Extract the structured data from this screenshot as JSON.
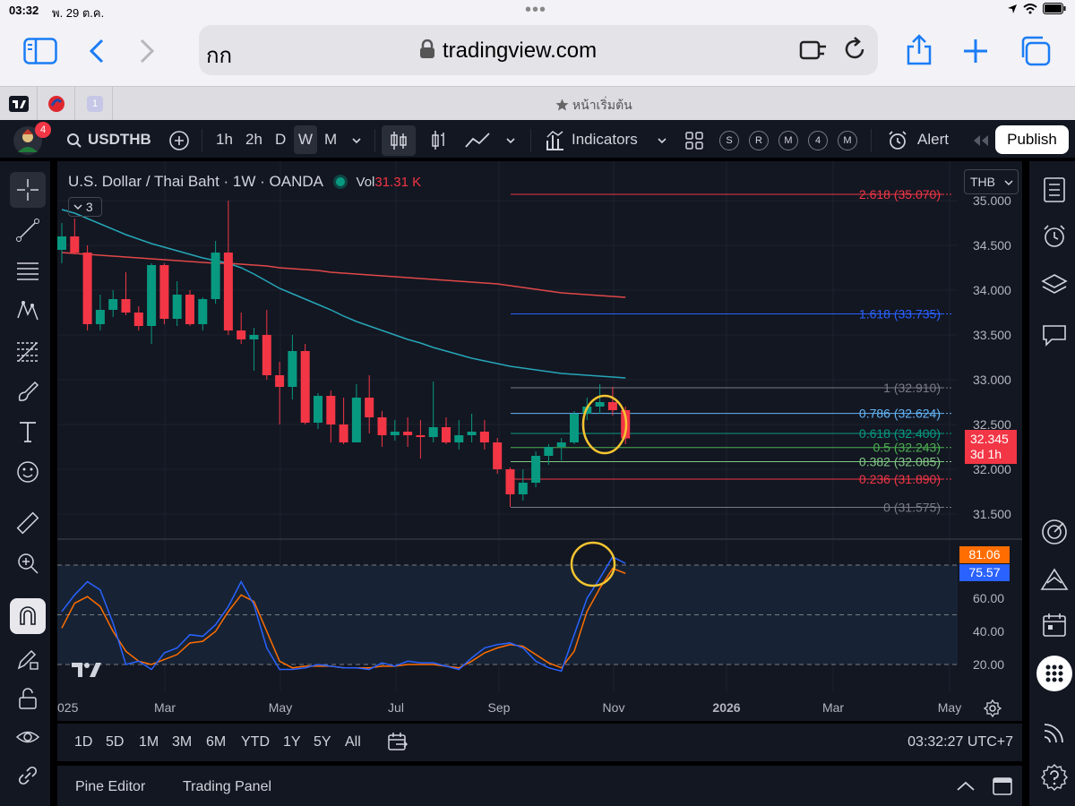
{
  "status": {
    "time": "03:32",
    "date": "พ. 29 ต.ค."
  },
  "safari": {
    "reader_label": "กก",
    "url": "tradingview.com",
    "tab_number": "1",
    "home_tab": "หน้าเริ่มต้น"
  },
  "toolbar": {
    "notification_count": "4",
    "symbol": "USDTHB",
    "intervals": [
      "1h",
      "2h",
      "D",
      "W",
      "M"
    ],
    "active_interval": "W",
    "indicators_label": "Indicators",
    "chips": [
      "S",
      "R",
      "M",
      "4",
      "M"
    ],
    "alert_label": "Alert",
    "publish_label": "Publish"
  },
  "chart": {
    "title": "U.S. Dollar / Thai Baht · 1W · OANDA",
    "vol_label": "Vol",
    "vol_value": "31.31 K",
    "collapse_count": "3",
    "currency": "THB",
    "current_price": "32.345",
    "countdown": "3d 1h",
    "price_axis": [
      "35.000",
      "34.500",
      "34.000",
      "33.500",
      "33.000",
      "32.500",
      "32.000",
      "31.500"
    ],
    "fib_levels": [
      {
        "label": "2.618 (35.070)",
        "value": 35.07,
        "color": "#f23645"
      },
      {
        "label": "1.618 (33.735)",
        "value": 33.735,
        "color": "#2962ff"
      },
      {
        "label": "1 (32.910)",
        "value": 32.91,
        "color": "#787b86"
      },
      {
        "label": "0.786 (32.624)",
        "value": 32.624,
        "color": "#64b5f6"
      },
      {
        "label": "0.618 (32.400)",
        "value": 32.4,
        "color": "#089981"
      },
      {
        "label": "0.5 (32.243)",
        "value": 32.243,
        "color": "#4caf50"
      },
      {
        "label": "0.382 (32.085)",
        "value": 32.085,
        "color": "#81c784"
      },
      {
        "label": "0.236 (31.890)",
        "value": 31.89,
        "color": "#f23645"
      },
      {
        "label": "0 (31.575)",
        "value": 31.575,
        "color": "#787b86"
      }
    ],
    "osc_axis": [
      "60.00",
      "40.00",
      "20.00"
    ],
    "osc_k": "81.06",
    "osc_d": "75.57",
    "time_axis": [
      "025",
      "Mar",
      "May",
      "Jul",
      "Sep",
      "Nov",
      "2026",
      "Mar",
      "May"
    ],
    "colors": {
      "up": "#089981",
      "down": "#f23645",
      "ma_fast": "#26a6b8",
      "ma_slow": "#e04848",
      "k": "#2962ff",
      "d": "#ff6d00",
      "highlight": "#f5c531"
    }
  },
  "chart_data": {
    "type": "candlestick",
    "title": "U.S. Dollar / Thai Baht · 1W · OANDA",
    "x_ticks": [
      "025",
      "Mar",
      "May",
      "Jul",
      "Sep",
      "Nov",
      "2026",
      "Mar",
      "May"
    ],
    "ylim": [
      31.3,
      35.3
    ],
    "candles": [
      [
        34.45,
        34.75,
        34.3,
        34.6
      ],
      [
        34.6,
        34.8,
        34.4,
        34.42
      ],
      [
        34.42,
        34.5,
        33.55,
        33.62
      ],
      [
        33.62,
        33.95,
        33.55,
        33.78
      ],
      [
        33.78,
        34.0,
        33.7,
        33.9
      ],
      [
        33.9,
        34.2,
        33.72,
        33.75
      ],
      [
        33.75,
        33.82,
        33.55,
        33.6
      ],
      [
        33.6,
        34.3,
        33.4,
        34.28
      ],
      [
        34.28,
        34.3,
        33.62,
        33.68
      ],
      [
        33.68,
        34.1,
        33.6,
        33.95
      ],
      [
        33.95,
        34.0,
        33.6,
        33.62
      ],
      [
        33.62,
        33.92,
        33.55,
        33.9
      ],
      [
        33.9,
        34.55,
        33.85,
        34.42
      ],
      [
        34.42,
        35.0,
        33.5,
        33.55
      ],
      [
        33.55,
        33.75,
        33.4,
        33.45
      ],
      [
        33.45,
        33.58,
        33.1,
        33.5
      ],
      [
        33.5,
        33.78,
        33.0,
        33.05
      ],
      [
        33.05,
        33.2,
        32.5,
        32.92
      ],
      [
        32.92,
        33.5,
        32.78,
        33.32
      ],
      [
        33.32,
        33.4,
        32.5,
        32.52
      ],
      [
        32.52,
        32.85,
        32.45,
        32.82
      ],
      [
        32.82,
        32.88,
        32.3,
        32.5
      ],
      [
        32.5,
        32.8,
        32.28,
        32.3
      ],
      [
        32.3,
        32.95,
        32.3,
        32.8
      ],
      [
        32.8,
        33.05,
        32.4,
        32.58
      ],
      [
        32.58,
        32.65,
        32.25,
        32.38
      ],
      [
        32.38,
        32.55,
        32.32,
        32.42
      ],
      [
        32.42,
        32.58,
        32.25,
        32.38
      ],
      [
        32.38,
        32.55,
        32.12,
        32.36
      ],
      [
        32.36,
        32.98,
        32.3,
        32.47
      ],
      [
        32.47,
        32.58,
        32.28,
        32.3
      ],
      [
        32.3,
        32.55,
        32.22,
        32.38
      ],
      [
        32.38,
        32.62,
        32.3,
        32.42
      ],
      [
        32.42,
        32.55,
        32.22,
        32.3
      ],
      [
        32.3,
        32.35,
        31.95,
        32.0
      ],
      [
        32.0,
        32.02,
        31.58,
        31.72
      ],
      [
        31.72,
        32.0,
        31.65,
        31.85
      ],
      [
        31.85,
        32.2,
        31.8,
        32.15
      ],
      [
        32.15,
        32.28,
        32.05,
        32.25
      ],
      [
        32.25,
        32.35,
        32.1,
        32.3
      ],
      [
        32.3,
        32.65,
        32.28,
        32.62
      ],
      [
        32.62,
        32.8,
        32.55,
        32.7
      ],
      [
        32.7,
        32.95,
        32.62,
        32.75
      ],
      [
        32.75,
        32.92,
        32.6,
        32.66
      ],
      [
        32.66,
        32.7,
        32.28,
        32.345
      ]
    ],
    "ma_fast": [
      34.9,
      34.86,
      34.8,
      34.74,
      34.68,
      34.62,
      34.57,
      34.52,
      34.48,
      34.44,
      34.4,
      34.36,
      34.33,
      34.3,
      34.25,
      34.18,
      34.1,
      34.02,
      33.96,
      33.9,
      33.84,
      33.78,
      33.71,
      33.65,
      33.6,
      33.55,
      33.5,
      33.45,
      33.41,
      33.36,
      33.32,
      33.28,
      33.24,
      33.21,
      33.18,
      33.15,
      33.13,
      33.11,
      33.09,
      33.07,
      33.06,
      33.05,
      33.04,
      33.03,
      33.02
    ],
    "ma_slow": [
      34.42,
      34.41,
      34.4,
      34.39,
      34.38,
      34.37,
      34.36,
      34.35,
      34.34,
      34.33,
      34.32,
      34.31,
      34.3,
      34.3,
      34.29,
      34.28,
      34.27,
      34.25,
      34.24,
      34.23,
      34.22,
      34.2,
      34.19,
      34.18,
      34.17,
      34.16,
      34.15,
      34.14,
      34.13,
      34.12,
      34.11,
      34.1,
      34.09,
      34.08,
      34.07,
      34.05,
      34.03,
      34.01,
      33.99,
      33.97,
      33.96,
      33.95,
      33.94,
      33.93,
      33.92
    ],
    "oscillator": {
      "k": [
        52,
        62,
        70,
        65,
        45,
        20,
        22,
        17,
        27,
        30,
        38,
        37,
        44,
        55,
        70,
        56,
        30,
        17,
        17,
        18,
        20,
        19,
        18,
        18,
        17,
        21,
        19,
        22,
        21,
        21,
        19,
        17,
        24,
        30,
        32,
        33,
        30,
        22,
        18,
        16,
        38,
        60,
        72,
        85,
        81
      ],
      "d": [
        42,
        57,
        61,
        55,
        40,
        28,
        22,
        20,
        23,
        26,
        33,
        34,
        40,
        52,
        62,
        58,
        40,
        22,
        18,
        19,
        19,
        19,
        18,
        18,
        18,
        19,
        19,
        20,
        20,
        20,
        19,
        18,
        22,
        27,
        30,
        32,
        31,
        26,
        21,
        18,
        28,
        52,
        66,
        78,
        75
      ],
      "levels": [
        80,
        50,
        20
      ],
      "ylim": [
        10,
        90
      ]
    }
  },
  "range": {
    "buttons": [
      "1D",
      "5D",
      "1M",
      "3M",
      "6M",
      "YTD",
      "1Y",
      "5Y",
      "All"
    ],
    "clock": "03:32:27 UTC+7"
  },
  "panel": {
    "pine_label": "Pine Editor",
    "trading_label": "Trading Panel"
  }
}
